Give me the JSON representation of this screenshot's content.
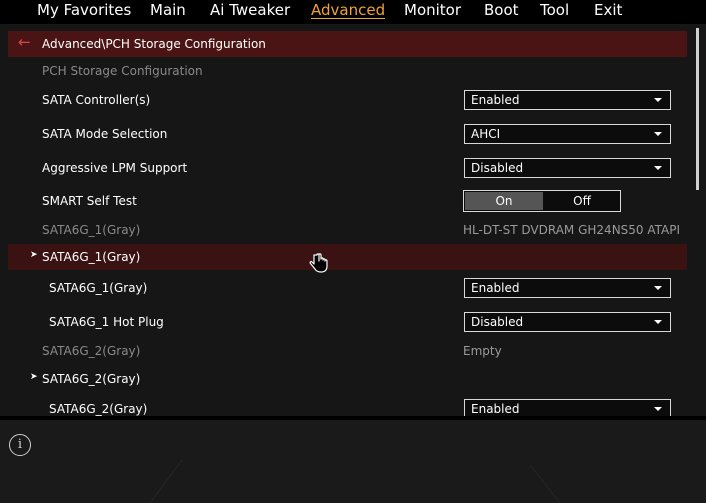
{
  "menu": [
    {
      "label": "My Favorites",
      "active": false
    },
    {
      "label": "Main",
      "active": false
    },
    {
      "label": "Ai Tweaker",
      "active": false
    },
    {
      "label": "Advanced",
      "active": true
    },
    {
      "label": "Monitor",
      "active": false
    },
    {
      "label": "Boot",
      "active": false
    },
    {
      "label": "Tool",
      "active": false
    },
    {
      "label": "Exit",
      "active": false
    }
  ],
  "breadcrumb": "Advanced\\PCH Storage Configuration",
  "section_title": "PCH Storage Configuration",
  "settings": {
    "sata_controller": {
      "label": "SATA Controller(s)",
      "value": "Enabled"
    },
    "sata_mode": {
      "label": "SATA Mode Selection",
      "value": "AHCI"
    },
    "aggressive_lpm": {
      "label": "Aggressive LPM Support",
      "value": "Disabled"
    },
    "smart_self_test": {
      "label": "SMART Self Test",
      "on_label": "On",
      "off_label": "Off",
      "selected": "On"
    },
    "port1_info": {
      "label": "SATA6G_1(Gray)",
      "value": "HL-DT-ST DVDRAM GH24NS50 ATAPI"
    },
    "port1_group": {
      "label": "SATA6G_1(Gray)"
    },
    "port1_enable": {
      "label": "SATA6G_1(Gray)",
      "value": "Enabled"
    },
    "port1_hotplug": {
      "label": "SATA6G_1 Hot Plug",
      "value": "Disabled"
    },
    "port2_info": {
      "label": "SATA6G_2(Gray)",
      "value": "Empty"
    },
    "port2_group": {
      "label": "SATA6G_2(Gray)"
    },
    "port2_enable": {
      "label": "SATA6G_2(Gray)",
      "value": "Enabled"
    }
  },
  "icons": {
    "back": "back-arrow-icon",
    "expand": "triangle-right-icon",
    "cursor": "hand-pointer-icon",
    "info": "info-icon"
  },
  "colors": {
    "accent": "#f0a23a",
    "breadcrumb_bg": "#4a1414",
    "highlight_bg": "#3a1212",
    "back_arrow": "#d94848"
  }
}
